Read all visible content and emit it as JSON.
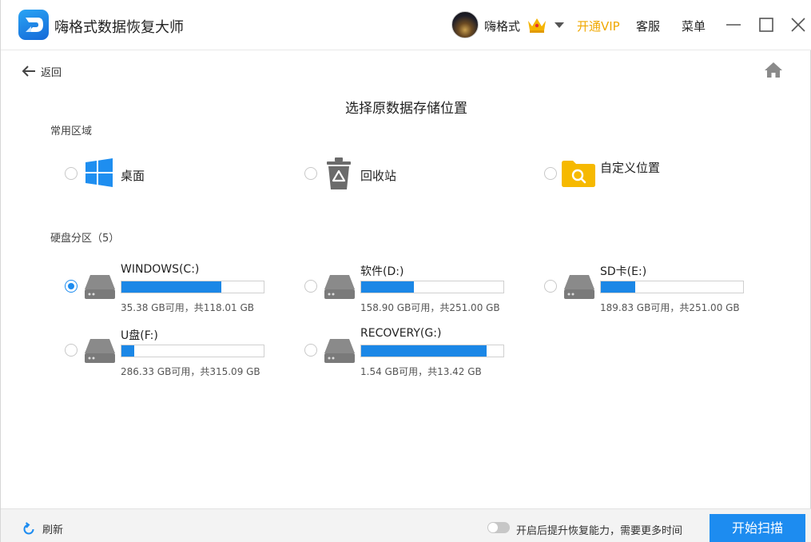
{
  "app": {
    "title": "嗨格式数据恢复大师"
  },
  "user": {
    "name": "嗨格式"
  },
  "header": {
    "vip_label": "开通VIP",
    "service_label": "客服",
    "menu_label": "菜单"
  },
  "nav": {
    "back_label": "返回"
  },
  "page": {
    "title": "选择原数据存储位置"
  },
  "common": {
    "label": "常用区域",
    "items": [
      {
        "label": "桌面",
        "icon": "windows-icon",
        "selected": false
      },
      {
        "label": "回收站",
        "icon": "recycle-bin-icon",
        "selected": false
      },
      {
        "label": "自定义位置",
        "icon": "custom-folder-icon",
        "selected": false
      }
    ]
  },
  "drives": {
    "label": "硬盘分区（5）",
    "items": [
      {
        "name": "WINDOWS(C:)",
        "size_text": "35.38 GB可用，共118.01 GB",
        "used_fraction": 0.7,
        "selected": true
      },
      {
        "name": "软件(D:)",
        "size_text": "158.90 GB可用，共251.00 GB",
        "used_fraction": 0.37,
        "selected": false
      },
      {
        "name": "SD卡(E:)",
        "size_text": "189.83 GB可用，共251.00 GB",
        "used_fraction": 0.24,
        "selected": false
      },
      {
        "name": "U盘(F:)",
        "size_text": "286.33 GB可用，共315.09 GB",
        "used_fraction": 0.09,
        "selected": false
      },
      {
        "name": "RECOVERY(G:)",
        "size_text": "1.54 GB可用，共13.42 GB",
        "used_fraction": 0.88,
        "selected": false
      }
    ]
  },
  "footer": {
    "refresh_label": "刷新",
    "toggle_label": "开启后提升恢复能力，需要更多时间",
    "toggle_on": false,
    "scan_label": "开始扫描"
  },
  "colors": {
    "accent": "#1d8cf0",
    "vip": "#f0a800",
    "bar_fill": "#1b87e6"
  }
}
